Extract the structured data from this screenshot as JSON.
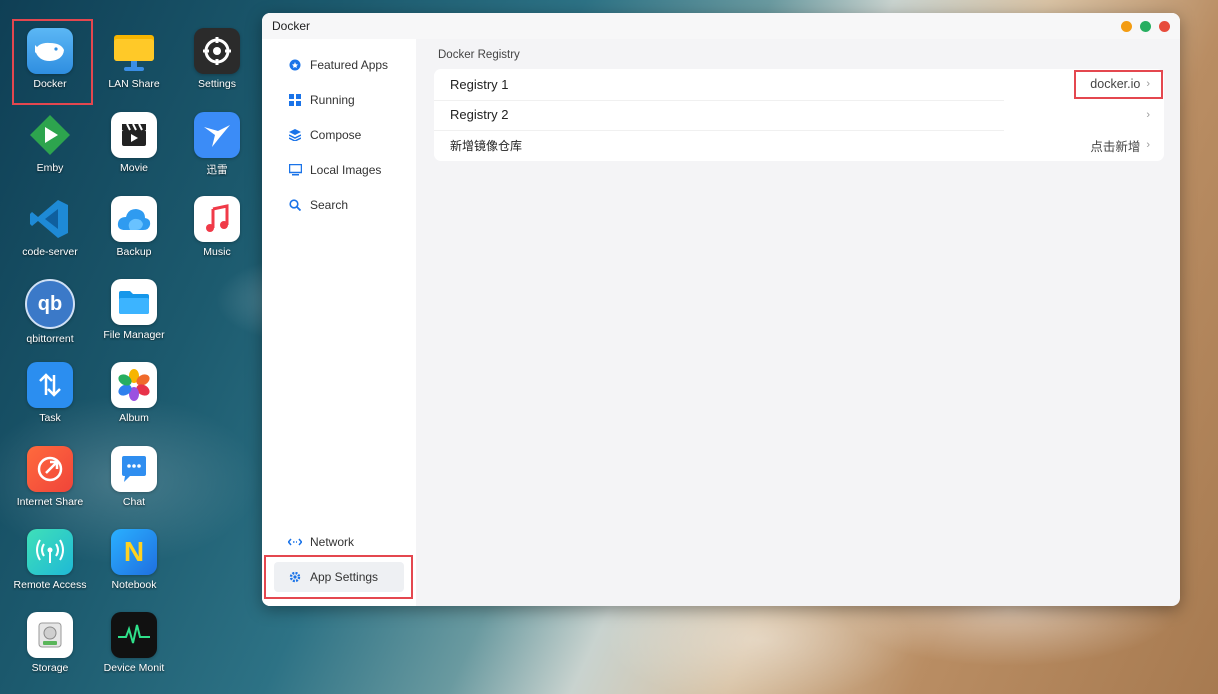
{
  "desktop": {
    "icons": [
      {
        "label": "Docker",
        "icon": "docker-whale-icon",
        "color": "#3aa0e8"
      },
      {
        "label": "LAN Share",
        "icon": "lan-share-folder-icon",
        "color": "#f5b800"
      },
      {
        "label": "Settings",
        "icon": "settings-gear-icon",
        "color": "#2b2b2b"
      },
      {
        "label": "Emby",
        "icon": "emby-play-icon",
        "color": "#2da44e"
      },
      {
        "label": "Movie",
        "icon": "clapperboard-icon",
        "color": "#ffffff"
      },
      {
        "label": "迅雷",
        "icon": "thunder-bird-icon",
        "color": "#3b8cf7"
      },
      {
        "label": "code-server",
        "icon": "vscode-icon",
        "color": "#1e8ad6"
      },
      {
        "label": "Backup",
        "icon": "cloud-icon",
        "color": "#ffffff"
      },
      {
        "label": "Music",
        "icon": "music-note-icon",
        "color": "#ffffff"
      },
      {
        "label": "qbittorrent",
        "icon": "qbittorrent-icon",
        "color": "#3b79c8"
      },
      {
        "label": "File Manager",
        "icon": "folder-icon",
        "color": "#ffffff"
      },
      {
        "label": "Task",
        "icon": "task-arrows-icon",
        "color": "#2b8ef0"
      },
      {
        "label": "Album",
        "icon": "photos-flower-icon",
        "color": "#ffffff"
      },
      {
        "label": "Internet Share",
        "icon": "internet-share-icon",
        "color": "#f0443a"
      },
      {
        "label": "Chat",
        "icon": "chat-bubble-icon",
        "color": "#ffffff"
      },
      {
        "label": "Remote Access",
        "icon": "remote-access-icon",
        "color": "#24c6a6"
      },
      {
        "label": "Notebook",
        "icon": "notebook-icon",
        "color": "#1f8be8"
      },
      {
        "label": "Storage",
        "icon": "storage-drive-icon",
        "color": "#ffffff"
      },
      {
        "label": "Device Monit",
        "icon": "heart-monitor-icon",
        "color": "#111111"
      }
    ]
  },
  "window": {
    "title": "Docker",
    "controls": {
      "minimize": "#f39c12",
      "maximize": "#27ae60",
      "close": "#e74c3c"
    }
  },
  "sidebar": {
    "items": [
      {
        "label": "Featured Apps",
        "icon": "featured-icon"
      },
      {
        "label": "Running",
        "icon": "grid-icon"
      },
      {
        "label": "Compose",
        "icon": "layers-icon"
      },
      {
        "label": "Local Images",
        "icon": "monitor-icon"
      },
      {
        "label": "Search",
        "icon": "search-icon"
      },
      {
        "label": "Network",
        "icon": "network-arrows-icon"
      },
      {
        "label": "App Settings",
        "icon": "gear-icon",
        "active": true
      }
    ]
  },
  "main": {
    "section_title": "Docker Registry",
    "rows": [
      {
        "label": "Registry 1",
        "value": "docker.io"
      },
      {
        "label": "Registry 2",
        "value": ""
      },
      {
        "label": "新增镜像仓库",
        "value": "点击新增"
      }
    ]
  }
}
